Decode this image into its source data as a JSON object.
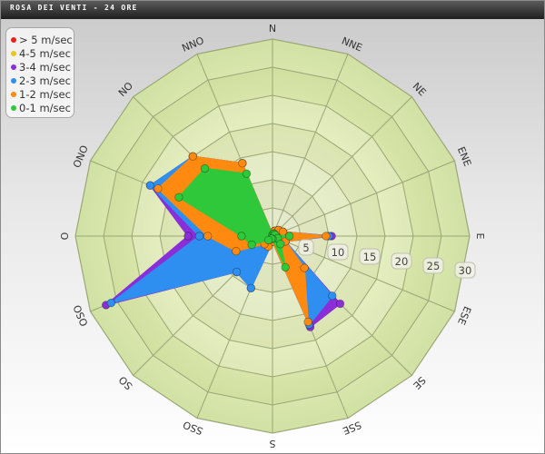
{
  "window": {
    "title": "Rosa dei venti - 24 ore"
  },
  "chart_data": {
    "type": "polar-area",
    "directions": [
      "N",
      "NNE",
      "NE",
      "ENE",
      "E",
      "ESE",
      "SE",
      "SSE",
      "S",
      "SSO",
      "SO",
      "OSO",
      "O",
      "ONO",
      "NO",
      "NNO"
    ],
    "radial_ticks": [
      5,
      10,
      15,
      20,
      25,
      30
    ],
    "radial_max": 35,
    "legend_position": "top-left",
    "series": [
      {
        "name": "> 5 m/sec",
        "color": "#e8231f",
        "values": [
          0,
          0,
          0,
          0,
          0,
          0,
          0,
          0,
          0,
          0,
          0,
          0,
          0,
          0,
          0,
          0
        ]
      },
      {
        "name": "4-5 m/sec",
        "color": "#e8c61f",
        "values": [
          0,
          0,
          0,
          0,
          0,
          0,
          0,
          0,
          0,
          0,
          0,
          0,
          0,
          0,
          0,
          0
        ]
      },
      {
        "name": "3-4 m/sec",
        "color": "#8a2fd8",
        "values": [
          0.3,
          1,
          1.5,
          2,
          10.5,
          2.5,
          17,
          17.5,
          1,
          10,
          9,
          32,
          15,
          23.5,
          20,
          14
        ]
      },
      {
        "name": "2-3 m/sec",
        "color": "#2f8ff0",
        "values": [
          0.3,
          1,
          1.5,
          2,
          10,
          2.5,
          15,
          17,
          1,
          10,
          9,
          31,
          13,
          23.5,
          20,
          14
        ]
      },
      {
        "name": "1-2 m/sec",
        "color": "#ff8a0f",
        "values": [
          0.3,
          1,
          1.5,
          2,
          9.5,
          2.5,
          8,
          16.5,
          1,
          2,
          2,
          7,
          11.5,
          22,
          20,
          14
        ]
      },
      {
        "name": "0-1 m/sec",
        "color": "#2ec83a",
        "values": [
          0.2,
          0.5,
          0.5,
          0.5,
          3,
          1,
          2,
          6,
          0.5,
          0.5,
          1,
          4,
          5.5,
          18,
          17,
          12
        ]
      }
    ]
  }
}
